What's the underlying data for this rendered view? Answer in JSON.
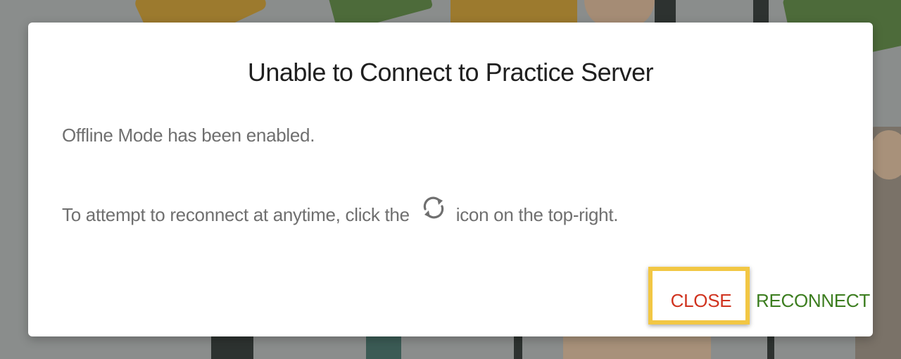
{
  "dialog": {
    "title": "Unable to Connect to Practice Server",
    "message_line1": "Offline Mode has been enabled.",
    "message_line2_prefix": "To attempt to reconnect at anytime, click the",
    "message_line2_icon": "refresh-icon",
    "message_line2_suffix": "icon on the top-right."
  },
  "buttons": {
    "close_label": "CLOSE",
    "reconnect_label": "RECONNECT"
  },
  "colors": {
    "close": "#d0331f",
    "reconnect": "#3c7d1f",
    "highlight": "#f2c744"
  }
}
